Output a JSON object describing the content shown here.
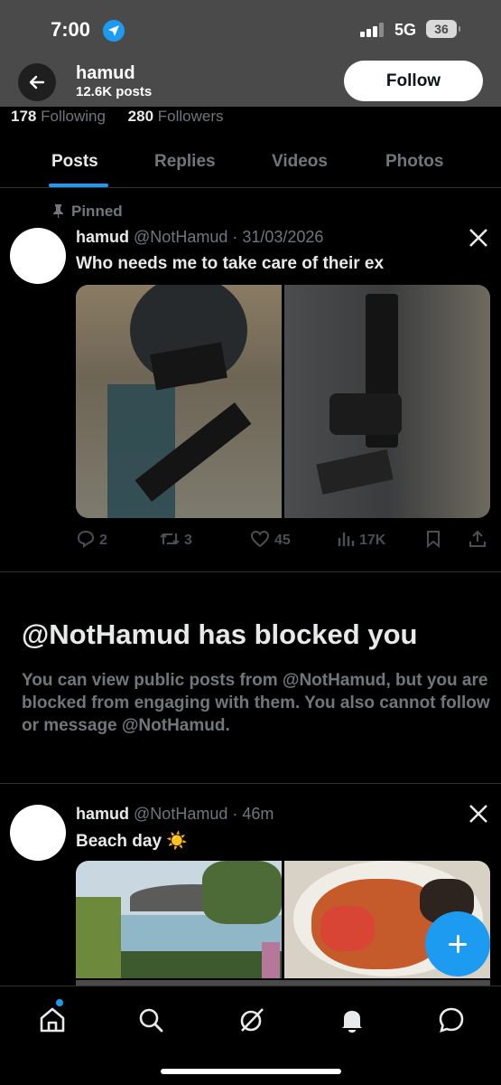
{
  "status_bar": {
    "time": "7:00",
    "network": "5G",
    "battery": "36"
  },
  "header": {
    "name": "hamud",
    "posts_count": "12.6K posts",
    "follow_label": "Follow"
  },
  "stats": {
    "following_count": "178",
    "following_label": "Following",
    "followers_count": "280",
    "followers_label": "Followers"
  },
  "tabs": [
    {
      "label": "Posts",
      "active": true
    },
    {
      "label": "Replies"
    },
    {
      "label": "Videos"
    },
    {
      "label": "Photos"
    }
  ],
  "posts": [
    {
      "pinned_label": "Pinned",
      "name": "hamud",
      "handle": "@NotHamud",
      "time": "31/03/2026",
      "text": "Who needs me to take care of their ex",
      "stats": {
        "replies": "2",
        "reposts": "3",
        "likes": "45",
        "views": "17K"
      }
    },
    {
      "name": "hamud",
      "handle": "@NotHamud",
      "time": "46m",
      "text": "Beach day ☀️"
    }
  ],
  "blocked": {
    "title": "@NotHamud has blocked you",
    "message": "You can view public posts from @NotHamud, but you are blocked from engaging with them. You also cannot follow or message @NotHamud."
  },
  "icons": [
    "back-arrow-icon",
    "location-arrow-icon",
    "pin-icon",
    "x-logo-icon",
    "reply-icon",
    "repost-icon",
    "like-icon",
    "views-icon",
    "bookmark-icon",
    "share-icon",
    "compose-icon",
    "home-icon",
    "search-icon",
    "grok-icon",
    "notifications-icon",
    "messages-icon"
  ],
  "colors": {
    "accent": "#1d9bf0",
    "background": "#000000",
    "header_bg": "#4a4a4a",
    "muted_text": "#71767b"
  }
}
